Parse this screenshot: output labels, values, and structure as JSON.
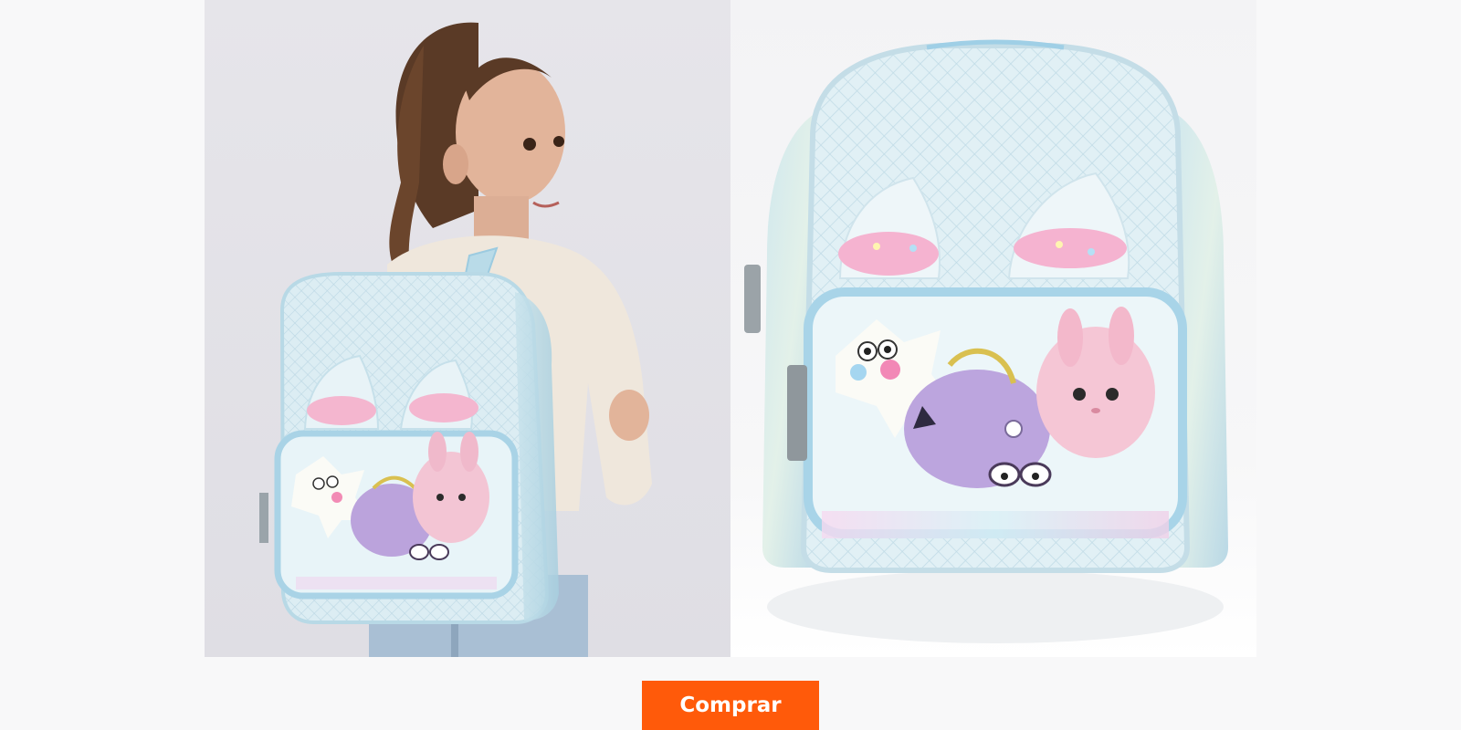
{
  "product": {
    "images": [
      {
        "alt": "",
        "icon": "child-wearing-backpack-photo"
      },
      {
        "alt": "",
        "icon": "backpack-product-photo"
      }
    ]
  },
  "actions": {
    "buy_label": "Comprar"
  },
  "colors": {
    "button_bg": "#ff5a0a",
    "button_text": "#ffffff",
    "page_bg": "#f8f8f9",
    "backpack": "#dbeef5",
    "trim": "#a8d4e8",
    "pink": "#f0a8c8",
    "lilac": "#b9a0d8"
  }
}
